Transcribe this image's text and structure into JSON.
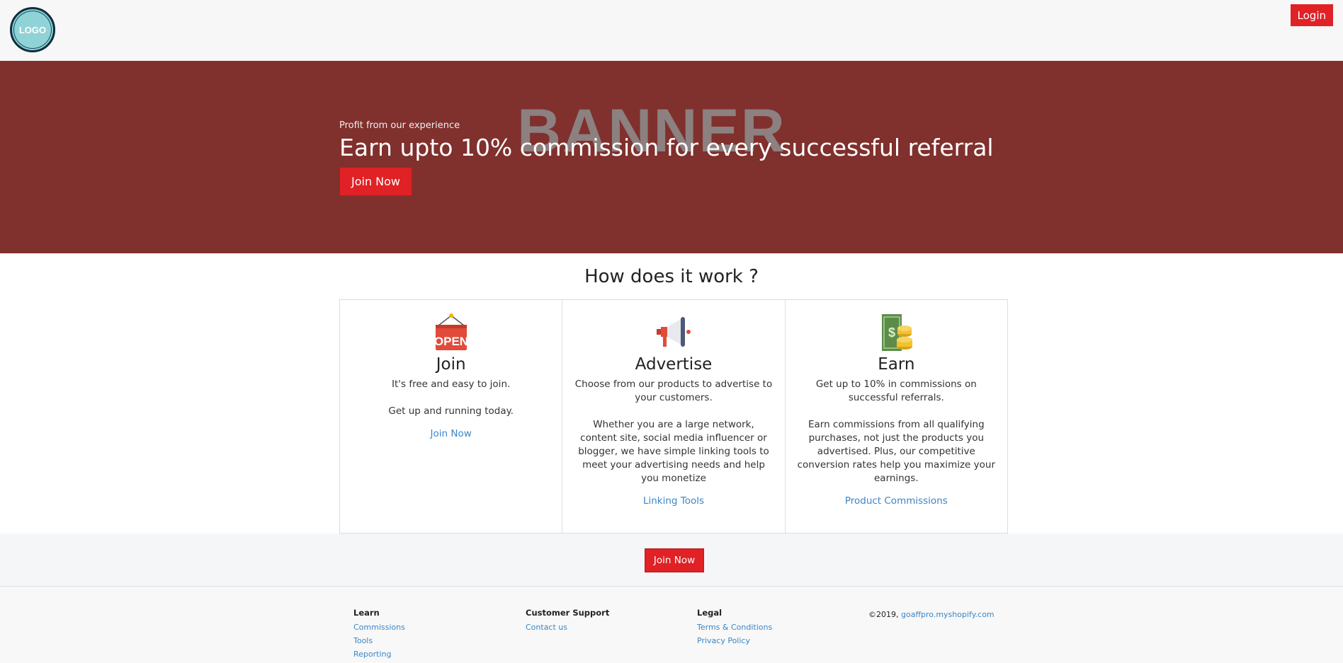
{
  "header": {
    "logo_text": "LOGO",
    "login_label": "Login"
  },
  "banner": {
    "watermark": "BANNER",
    "subtitle": "Profit from our experience",
    "title": "Earn upto 10% commission for every successful referral",
    "join_label": "Join Now"
  },
  "how": {
    "title": "How does it work ?",
    "cards": [
      {
        "icon": "open-sign-icon",
        "title": "Join",
        "text": "It's free and easy to join.\n\nGet up and running today.",
        "link": "Join Now"
      },
      {
        "icon": "megaphone-icon",
        "title": "Advertise",
        "text": "Choose from our products to advertise to your customers.\n\nWhether you are a large network, content site, social media influencer or blogger, we have simple linking tools to meet your advertising needs and help you monetize",
        "link": "Linking Tools"
      },
      {
        "icon": "money-coins-icon",
        "title": "Earn",
        "text": "Get up to 10% in commissions on successful referrals.\n\nEarn commissions from all qualifying purchases, not just the products you advertised. Plus, our competitive conversion rates help you maximize your earnings.",
        "link": "Product Commissions"
      }
    ]
  },
  "join_bar": {
    "label": "Join Now"
  },
  "footer": {
    "learn": {
      "heading": "Learn",
      "links": [
        "Commissions",
        "Tools",
        "Reporting"
      ]
    },
    "support": {
      "heading": "Customer Support",
      "links": [
        "Contact us"
      ]
    },
    "legal": {
      "heading": "Legal",
      "links": [
        "Terms & Conditions",
        "Privacy Policy"
      ]
    },
    "copyright": "©2019,",
    "site_link": "goaffpro.myshopify.com"
  },
  "colors": {
    "accent": "#e02125",
    "banner_bg": "#80302d",
    "link": "#3a86c8"
  }
}
